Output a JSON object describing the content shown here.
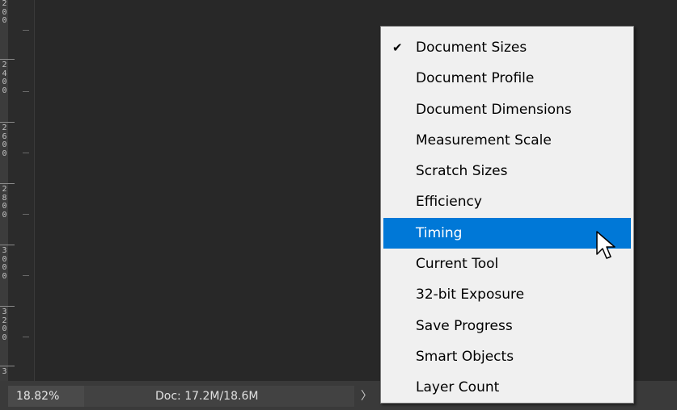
{
  "ruler": {
    "labels": [
      "2\n0\n0",
      "2\n4\n0\n0",
      "2\n6\n0\n0",
      "2\n8\n0\n0",
      "3\n0\n0\n0",
      "3\n2\n0\n0",
      "3"
    ]
  },
  "statusbar": {
    "zoom": "18.82%",
    "doc_info": "Doc: 17.2M/18.6M",
    "arrow": "〉"
  },
  "menu": {
    "items": [
      {
        "label": "Document Sizes",
        "checked": true
      },
      {
        "label": "Document Profile",
        "checked": false
      },
      {
        "label": "Document Dimensions",
        "checked": false
      },
      {
        "label": "Measurement Scale",
        "checked": false
      },
      {
        "label": "Scratch Sizes",
        "checked": false
      },
      {
        "label": "Efficiency",
        "checked": false
      },
      {
        "label": "Timing",
        "checked": false,
        "highlighted": true
      },
      {
        "label": "Current Tool",
        "checked": false
      },
      {
        "label": "32-bit Exposure",
        "checked": false
      },
      {
        "label": "Save Progress",
        "checked": false
      },
      {
        "label": "Smart Objects",
        "checked": false
      },
      {
        "label": "Layer Count",
        "checked": false
      }
    ],
    "check_glyph": "✔"
  },
  "colors": {
    "highlight": "#0078d7",
    "menu_bg": "#f0f0f0",
    "canvas_bg": "#282828"
  }
}
